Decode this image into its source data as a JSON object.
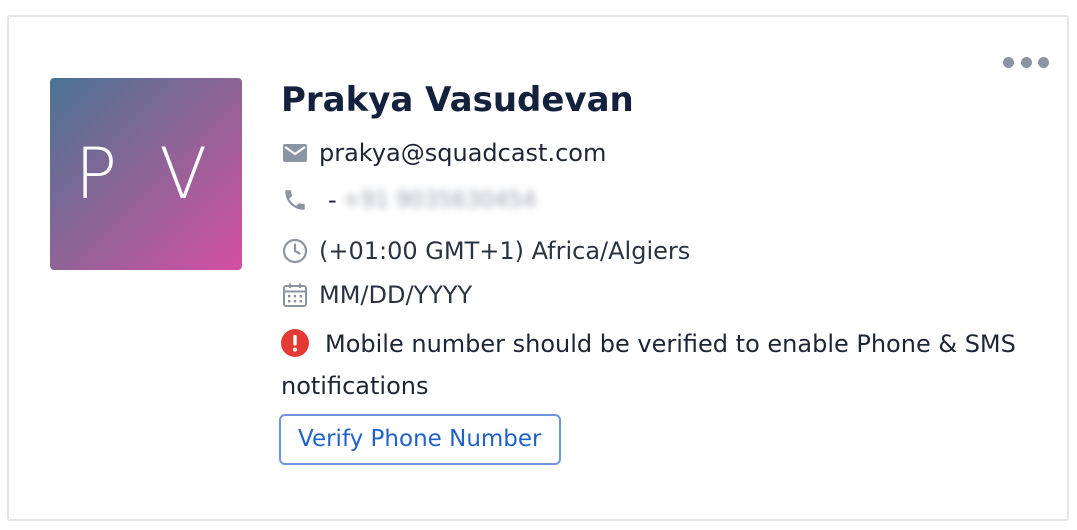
{
  "profile": {
    "initials": "P V",
    "name": "Prakya Vasudevan",
    "email": "prakya@squadcast.com",
    "phone_prefix": "-",
    "phone_number": "+91 9035630454",
    "timezone": "(+01:00 GMT+1) Africa/Algiers",
    "date_format": "MM/DD/YYYY"
  },
  "warning": {
    "text": "Mobile number should be verified to enable Phone & SMS notifications"
  },
  "actions": {
    "verify_label": "Verify Phone Number"
  },
  "icons": {
    "more": "more-horizontal-icon",
    "email": "envelope-icon",
    "phone": "phone-icon",
    "timezone": "clock-icon",
    "date": "calendar-icon",
    "warning": "alert-circle-icon"
  },
  "colors": {
    "name_text": "#14213d",
    "body_text": "#1d2635",
    "icon_gray": "#8b94a3",
    "warning_red": "#e53935",
    "button_border": "#6f95e0",
    "button_text": "#1f62c9",
    "avatar_gradient_start": "#4a7394",
    "avatar_gradient_end": "#d44fa5"
  }
}
